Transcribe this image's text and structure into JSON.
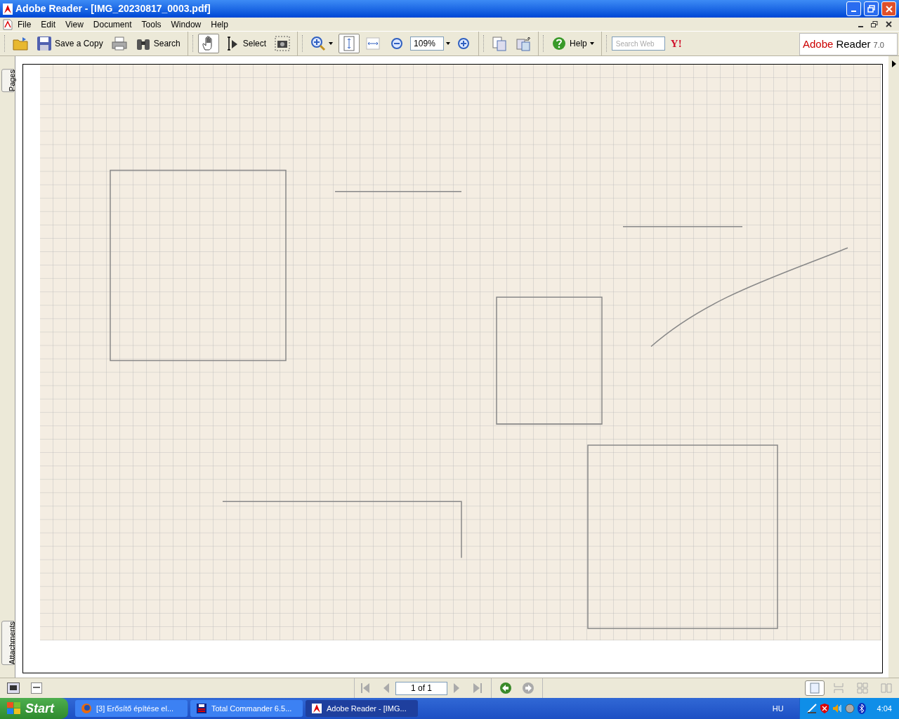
{
  "window": {
    "title": "Adobe Reader - [IMG_20230817_0003.pdf]"
  },
  "menu": [
    "File",
    "Edit",
    "View",
    "Document",
    "Tools",
    "Window",
    "Help"
  ],
  "toolbar": {
    "groups": [
      [
        {
          "kind": "button",
          "selected": false
        },
        {
          "kind": "button",
          "label": "Save a Copy",
          "selected": false
        },
        {
          "kind": "button",
          "selected": false
        },
        {
          "kind": "button",
          "label": "Search",
          "selected": false
        }
      ],
      [
        {
          "kind": "button",
          "selected": true
        },
        {
          "kind": "button",
          "label": "Select",
          "selected": false
        },
        {
          "kind": "button",
          "selected": false
        }
      ],
      [
        {
          "kind": "button",
          "dropdown": true,
          "selected": false
        },
        {
          "kind": "button",
          "selected": true
        },
        {
          "kind": "button",
          "selected": false
        },
        {
          "kind": "button",
          "selected": false
        },
        {
          "kind": "zoom_field",
          "value": "109%"
        },
        {
          "kind": "button",
          "selected": false
        }
      ],
      [
        {
          "kind": "button",
          "selected": false
        },
        {
          "kind": "button",
          "selected": false
        }
      ],
      [
        {
          "kind": "button",
          "label": "Help",
          "dropdown": true,
          "selected": false
        }
      ],
      [
        {
          "kind": "search_field",
          "placeholder": "Search Web"
        },
        {
          "kind": "text_button",
          "label": "Y!"
        }
      ]
    ],
    "logo": {
      "brand": "Adobe",
      "product": "Reader",
      "version": "7.0"
    }
  },
  "side_tabs": [
    {
      "label": "Pages"
    },
    {
      "label": "Attachments"
    }
  ],
  "navigation": {
    "page_field": "1 of 1"
  },
  "view_modes": [
    {
      "selected": true
    },
    {
      "selected": false
    },
    {
      "selected": false
    },
    {
      "selected": false
    }
  ],
  "taskbar": {
    "start": "Start",
    "tasks": [
      {
        "label": "[3] Erősítő építése el...",
        "selected": false
      },
      {
        "label": "Total Commander 6.5...",
        "selected": false
      },
      {
        "label": "Adobe Reader - [IMG...",
        "selected": true
      }
    ],
    "language": "HU",
    "clock": "4:04"
  }
}
